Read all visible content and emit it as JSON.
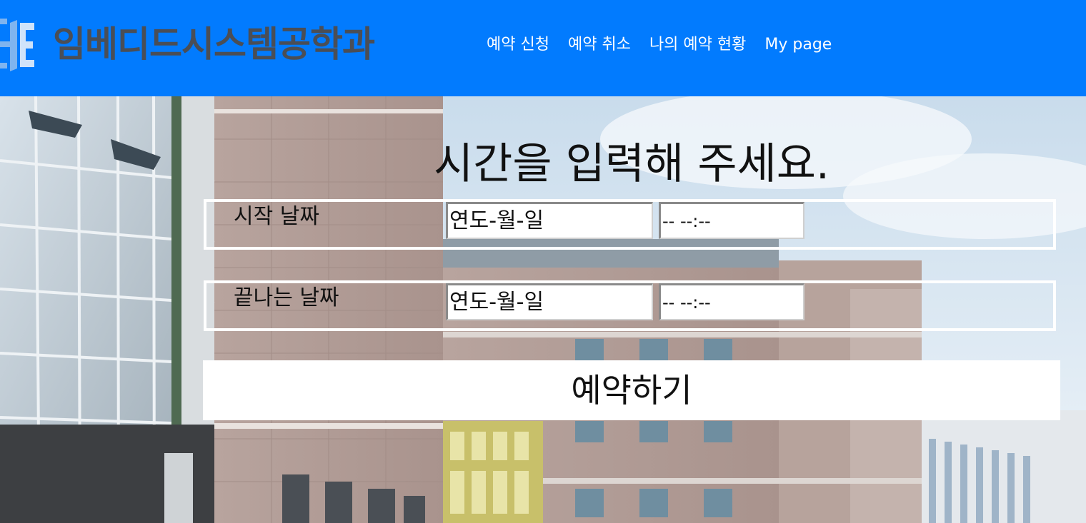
{
  "header": {
    "logo_text": "임베디드시스템공학과",
    "background_color": "#027bfe",
    "nav": [
      {
        "label": "예약 신청"
      },
      {
        "label": "예약 취소"
      },
      {
        "label": "나의 예약 현황"
      },
      {
        "label": "My page"
      }
    ]
  },
  "form": {
    "title": "시간을 입력해 주세요.",
    "start": {
      "label": "시작 날짜",
      "date_placeholder": "연도-월-일",
      "time_placeholder": "-- --:--"
    },
    "end": {
      "label": "끝나는 날짜",
      "date_placeholder": "연도-월-일",
      "time_placeholder": "-- --:--"
    },
    "submit_label": "예약하기"
  }
}
